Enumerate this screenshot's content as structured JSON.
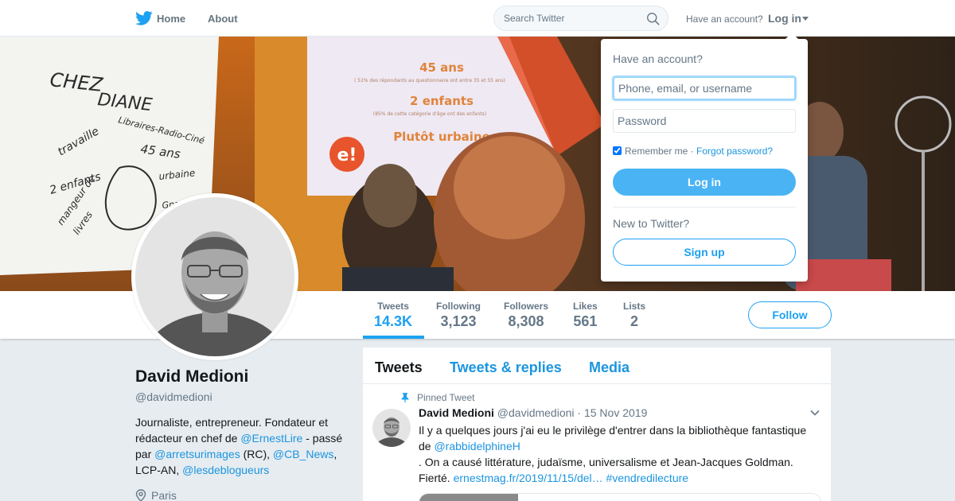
{
  "header": {
    "nav_home": "Home",
    "nav_about": "About",
    "search_placeholder": "Search Twitter",
    "have_account": "Have an account?",
    "login_label": "Log in"
  },
  "cover_image": {
    "flipchart_lines": [
      "CHEZ",
      "DIANE",
      "travaille",
      "Libraires-Radio-Ciné",
      "45 ans",
      "2 enfants",
      "urbaine",
      "mangeur de",
      "livres",
      "Gnaulle Ernest"
    ],
    "slide_lines": [
      "45 ans",
      "( 51% des répondants au questionnaire ont entre 35 et 55 ans)",
      "2 enfants",
      "(85% de cette catégorie d'âge ont des enfants)",
      "Plutôt urbaine",
      "e!"
    ],
    "colors": {
      "wall": "#d87a1a",
      "projection": "#efe9f4",
      "slide_accent": "#e8542b"
    }
  },
  "profile_nav": {
    "stats": [
      {
        "label": "Tweets",
        "value": "14.3K"
      },
      {
        "label": "Following",
        "value": "3,123"
      },
      {
        "label": "Followers",
        "value": "8,308"
      },
      {
        "label": "Likes",
        "value": "561"
      },
      {
        "label": "Lists",
        "value": "2"
      }
    ],
    "follow_label": "Follow"
  },
  "profile": {
    "name": "David Medioni",
    "handle": "@davidmedioni",
    "bio": {
      "t1": "Journaliste, entrepreneur. Fondateur et rédacteur en chef de ",
      "l1": "@ErnestLire",
      "t2": " - passé par ",
      "l2": "@arretsurimages",
      "t3": " (RC), ",
      "l3": "@CB_News",
      "t4": ", LCP-AN, ",
      "l4": "@lesdeblogueurs"
    },
    "location": "Paris"
  },
  "timeline": {
    "tabs": [
      "Tweets",
      "Tweets & replies",
      "Media"
    ],
    "tweet": {
      "pinned_label": "Pinned Tweet",
      "name": "David Medioni",
      "handle": "@davidmedioni",
      "dot": "·",
      "date": "15 Nov 2019",
      "text1": "Il y a quelques jours j'ai eu le privilège d'entrer dans la bibliothèque fantastique de ",
      "mention": "@rabbidelphineH",
      "text2": ". On a causé littérature, judaïsme, universalisme et Jean-Jacques Goldman. Fierté. ",
      "link": "ernestmag.fr/2019/11/15/del…",
      "hashtag": "#vendredilecture"
    }
  },
  "login_dropdown": {
    "title": "Have an account?",
    "username_placeholder": "Phone, email, or username",
    "password_placeholder": "Password",
    "remember_label": "Remember me",
    "separator": "·",
    "forgot_label": "Forgot password?",
    "login_button": "Log in",
    "new_label": "New to Twitter?",
    "signup_button": "Sign up"
  },
  "colors": {
    "accent": "#1da1f2",
    "link": "#1b95e0",
    "login_button": "#4ab3f4"
  },
  "icons": [
    "twitter-bird-icon",
    "search-icon",
    "chevron-down-icon",
    "pin-icon",
    "location-pin-icon"
  ]
}
